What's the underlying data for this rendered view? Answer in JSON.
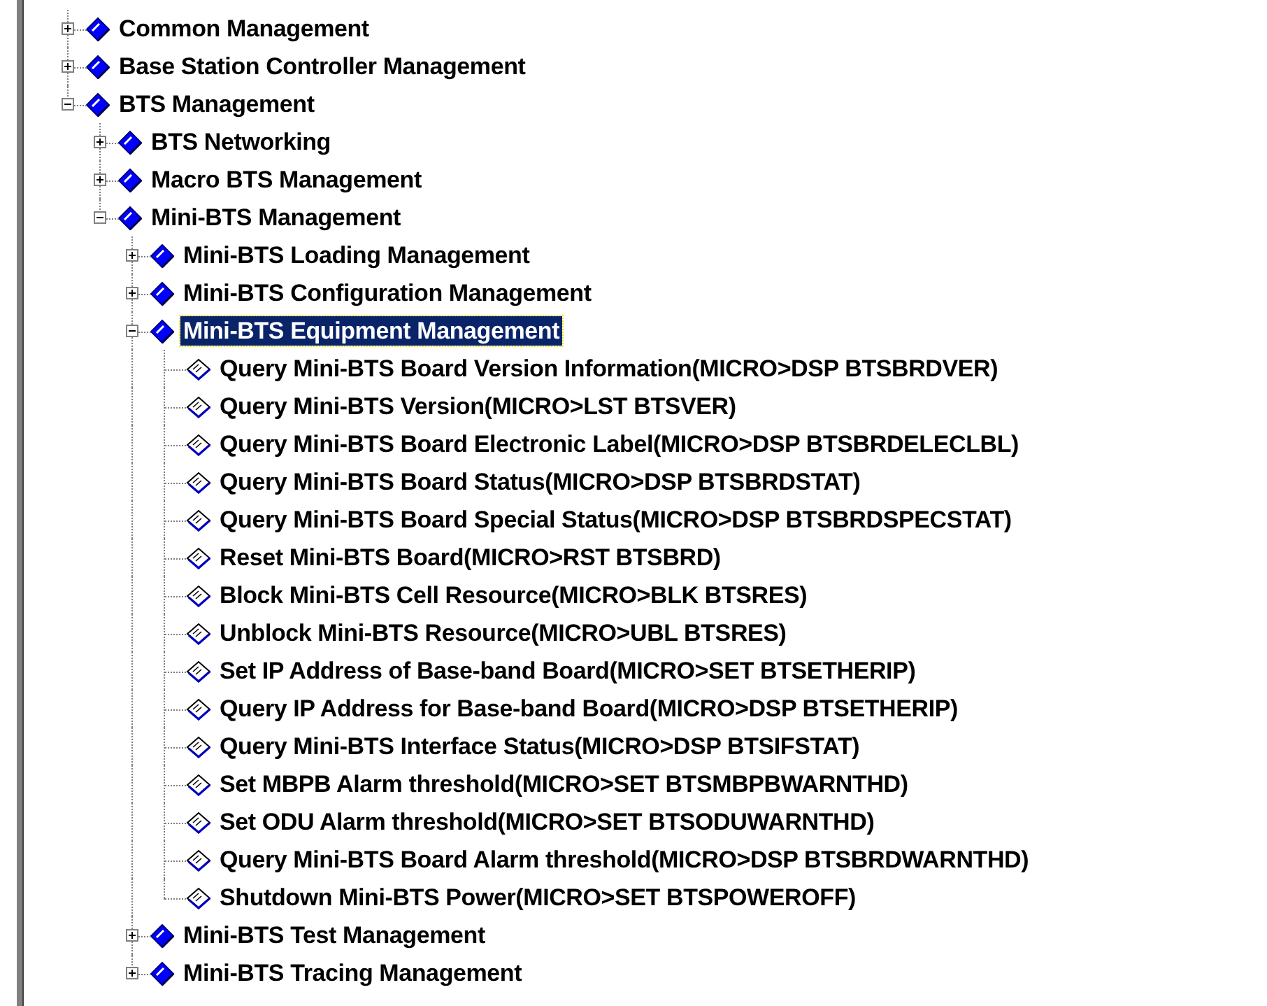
{
  "tree": [
    {
      "label": "Common Management",
      "kind": "folder",
      "expanded": false,
      "selected": false
    },
    {
      "label": "Base Station Controller Management",
      "kind": "folder",
      "expanded": false,
      "selected": false
    },
    {
      "label": "BTS Management",
      "kind": "folder",
      "expanded": true,
      "selected": false,
      "children": [
        {
          "label": "BTS Networking",
          "kind": "folder",
          "expanded": false,
          "selected": false
        },
        {
          "label": "Macro BTS Management",
          "kind": "folder",
          "expanded": false,
          "selected": false
        },
        {
          "label": "Mini-BTS Management",
          "kind": "folder",
          "expanded": true,
          "selected": false,
          "children": [
            {
              "label": "Mini-BTS Loading Management",
              "kind": "folder",
              "expanded": false,
              "selected": false
            },
            {
              "label": "Mini-BTS Configuration Management",
              "kind": "folder",
              "expanded": false,
              "selected": false
            },
            {
              "label": "Mini-BTS Equipment Management",
              "kind": "folder",
              "expanded": true,
              "selected": true,
              "children": [
                {
                  "label": "Query Mini-BTS Board Version Information(MICRO>DSP BTSBRDVER)",
                  "kind": "leaf",
                  "selected": false
                },
                {
                  "label": "Query Mini-BTS Version(MICRO>LST BTSVER)",
                  "kind": "leaf",
                  "selected": false
                },
                {
                  "label": "Query Mini-BTS Board Electronic Label(MICRO>DSP BTSBRDELECLBL)",
                  "kind": "leaf",
                  "selected": false
                },
                {
                  "label": "Query Mini-BTS Board Status(MICRO>DSP BTSBRDSTAT)",
                  "kind": "leaf",
                  "selected": false
                },
                {
                  "label": "Query Mini-BTS Board Special Status(MICRO>DSP BTSBRDSPECSTAT)",
                  "kind": "leaf",
                  "selected": false
                },
                {
                  "label": "Reset Mini-BTS Board(MICRO>RST BTSBRD)",
                  "kind": "leaf",
                  "selected": false
                },
                {
                  "label": "Block Mini-BTS Cell Resource(MICRO>BLK BTSRES)",
                  "kind": "leaf",
                  "selected": false
                },
                {
                  "label": "Unblock Mini-BTS Resource(MICRO>UBL BTSRES)",
                  "kind": "leaf",
                  "selected": false
                },
                {
                  "label": "Set IP Address of Base-band Board(MICRO>SET BTSETHERIP)",
                  "kind": "leaf",
                  "selected": false
                },
                {
                  "label": "Query IP Address for Base-band Board(MICRO>DSP BTSETHERIP)",
                  "kind": "leaf",
                  "selected": false
                },
                {
                  "label": "Query Mini-BTS Interface Status(MICRO>DSP BTSIFSTAT)",
                  "kind": "leaf",
                  "selected": false
                },
                {
                  "label": "Set MBPB Alarm threshold(MICRO>SET BTSMBPBWARNTHD)",
                  "kind": "leaf",
                  "selected": false
                },
                {
                  "label": "Set ODU Alarm threshold(MICRO>SET BTSODUWARNTHD)",
                  "kind": "leaf",
                  "selected": false
                },
                {
                  "label": "Query Mini-BTS Board Alarm threshold(MICRO>DSP BTSBRDWARNTHD)",
                  "kind": "leaf",
                  "selected": false
                },
                {
                  "label": "Shutdown Mini-BTS Power(MICRO>SET BTSPOWEROFF)",
                  "kind": "leaf",
                  "selected": false
                }
              ]
            },
            {
              "label": "Mini-BTS Test Management",
              "kind": "folder",
              "expanded": false,
              "selected": false
            },
            {
              "label": "Mini-BTS Tracing Management",
              "kind": "folder",
              "expanded": false,
              "selected": false
            }
          ]
        }
      ]
    }
  ]
}
